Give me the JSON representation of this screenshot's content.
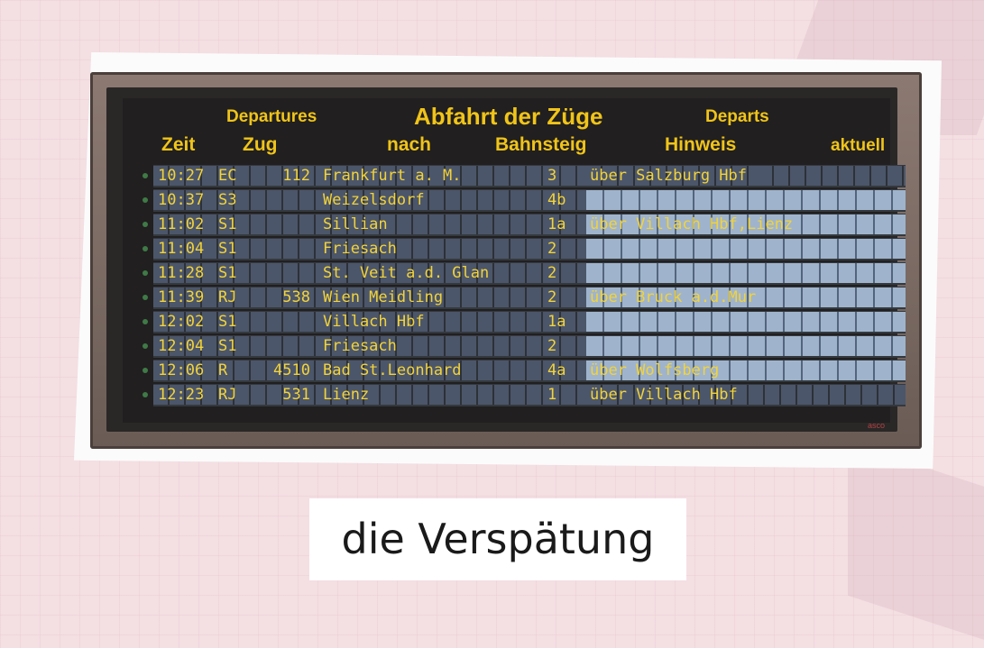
{
  "board": {
    "header": {
      "departures_en": "Departures",
      "title_de": "Abfahrt der Züge",
      "departs_fr": "Departs",
      "col_zeit": "Zeit",
      "col_zug": "Zug",
      "col_nach": "nach",
      "col_bahnsteig": "Bahnsteig",
      "col_hinweis": "Hinweis",
      "col_aktuell": "aktuell"
    },
    "rows": [
      {
        "time": "10:27",
        "type": "EC",
        "number": "112",
        "destination": "Frankfurt a. M.",
        "platform": "3",
        "note": "über Salzburg Hbf"
      },
      {
        "time": "10:37",
        "type": "S3",
        "number": "",
        "destination": "Weizelsdorf",
        "platform": "4b",
        "note": ""
      },
      {
        "time": "11:02",
        "type": "S1",
        "number": "",
        "destination": "Sillian",
        "platform": "1a",
        "note": "über Villach Hbf,Lienz"
      },
      {
        "time": "11:04",
        "type": "S1",
        "number": "",
        "destination": "Friesach",
        "platform": "2",
        "note": ""
      },
      {
        "time": "11:28",
        "type": "S1",
        "number": "",
        "destination": "St. Veit a.d. Glan",
        "platform": "2",
        "note": ""
      },
      {
        "time": "11:39",
        "type": "RJ",
        "number": "538",
        "destination": "Wien Meidling",
        "platform": "2",
        "note": "über Bruck a.d.Mur"
      },
      {
        "time": "12:02",
        "type": "S1",
        "number": "",
        "destination": "Villach Hbf",
        "platform": "1a",
        "note": ""
      },
      {
        "time": "12:04",
        "type": "S1",
        "number": "",
        "destination": "Friesach",
        "platform": "2",
        "note": ""
      },
      {
        "time": "12:06",
        "type": "R",
        "number": "4510",
        "destination": "Bad St.Leonhard",
        "platform": "4a",
        "note": "über Wolfsberg"
      },
      {
        "time": "12:23",
        "type": "RJ",
        "number": "531",
        "destination": "Lienz",
        "platform": "1",
        "note": "über Villach Hbf"
      }
    ],
    "brand": "asco"
  },
  "caption": "die Verspätung",
  "colors": {
    "text_yellow": "#f0c419",
    "board_dark": "#211f1f",
    "background_pink": "#f4dfe3"
  }
}
